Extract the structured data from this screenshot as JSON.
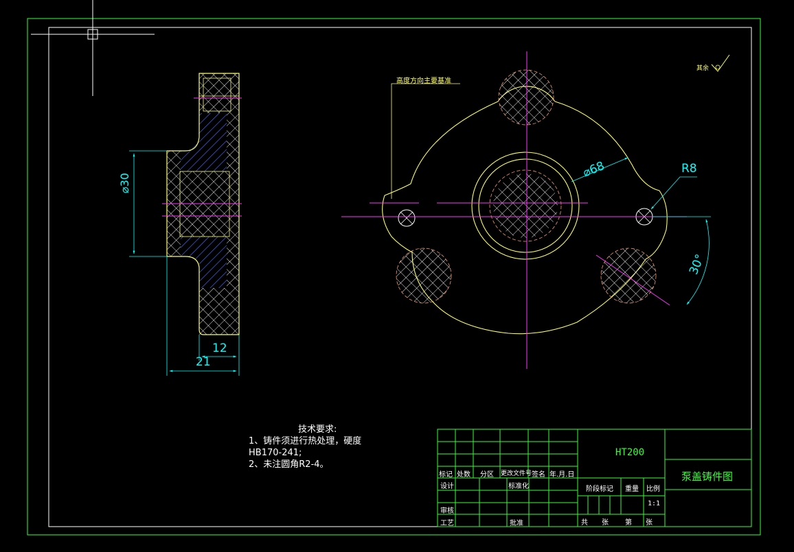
{
  "dims": {
    "diameter_30": "⌀30",
    "length_21": "21",
    "length_12": "12",
    "diameter_68": "⌀68",
    "radius_8": "R8",
    "angle_30": "30°"
  },
  "annotations": {
    "datum_label": "高度方向主要基准",
    "surface_roughness": "其余"
  },
  "technical_requirements": {
    "title": "技术要求:",
    "line1": "1、铸件须进行热处理，硬度",
    "line2": "HB170-241;",
    "line3": "2、未注圆角R2-4。"
  },
  "title_block": {
    "headers": {
      "mark": "标记",
      "count": "处数",
      "zone": "分区",
      "change_doc": "更改文件号",
      "signature": "签名",
      "date": "年.月.日"
    },
    "design": "设计",
    "standardization": "标准化",
    "review": "审核",
    "process": "工艺",
    "approve": "批准",
    "stage_mark": "阶段标记",
    "weight": "重量",
    "scale_label": "比例",
    "scale_value": "1:1",
    "total_sheets": "共　　张",
    "sheet_no": "第　　张",
    "material": "HT200",
    "drawing_name": "泵盖铸件图"
  },
  "colors": {
    "background": "#000000",
    "frame": "#ffffff",
    "outline": "#ffff66",
    "hatch": "#4060ff",
    "crosshatch": "#ffffff",
    "centerline": "#ff33ff",
    "dimension": "#00ffff",
    "title_block_grid": "#33ff33"
  }
}
